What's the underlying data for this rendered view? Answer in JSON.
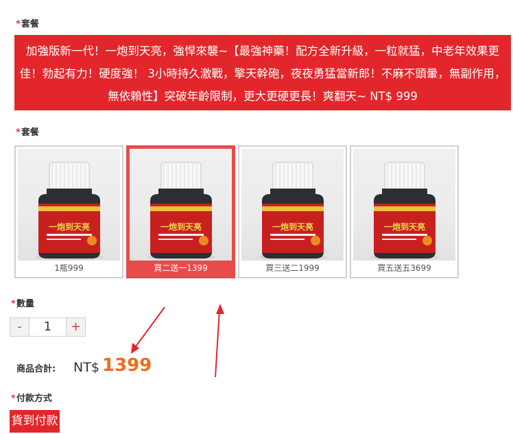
{
  "package_section": {
    "required_mark": "*",
    "label": "套餐",
    "description": "加強版新一代！一炮到天亮，強悍來襲~【最強神藥！配方全新升級，一粒就猛，中老年效果更佳！勃起有力！硬度強！ 3小時持久激戰，擎天幹砲，夜夜勇猛當新郎！不麻不頭暈，無副作用，無依賴性】突破年齡限制，更大更硬更長！爽翻天~ NT$ 999"
  },
  "options_section": {
    "required_mark": "*",
    "label": "套餐",
    "options": [
      {
        "caption": "1瓶999",
        "selected": false
      },
      {
        "caption": "買二送一1399",
        "selected": true
      },
      {
        "caption": "買三送二1999",
        "selected": false
      },
      {
        "caption": "買五送五3699",
        "selected": false
      }
    ],
    "bottle_label": "一炮到天亮"
  },
  "quantity": {
    "required_mark": "*",
    "label": "數量",
    "minus": "-",
    "value": "1",
    "plus": "+"
  },
  "total": {
    "label": "商品合計:",
    "currency": "NT$",
    "amount": "1399"
  },
  "payment": {
    "required_mark": "*",
    "label": "付款方式",
    "method": "貨到付款"
  },
  "colors": {
    "accent_red": "#e3262b",
    "selected_border": "#e84b4b",
    "price_orange": "#f26b1d"
  }
}
